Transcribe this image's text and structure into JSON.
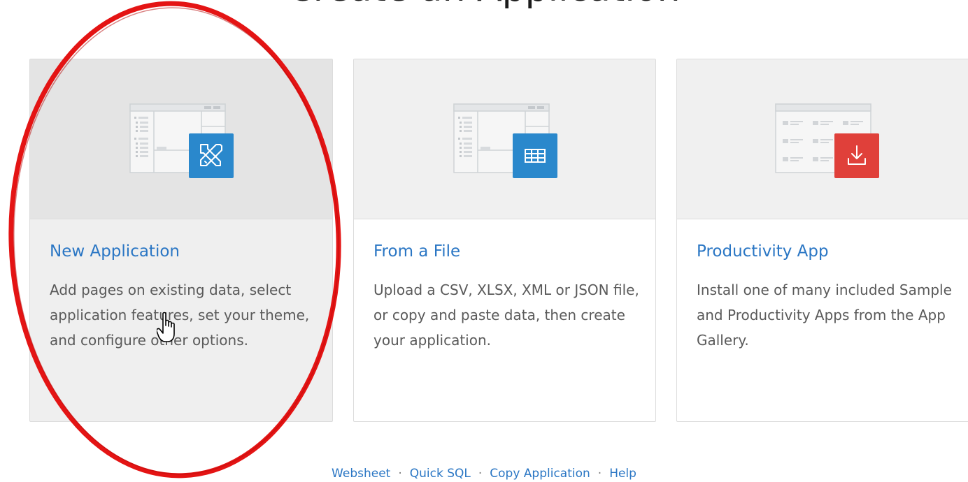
{
  "page": {
    "title": "Create an Application"
  },
  "cards": [
    {
      "title": "New Application",
      "description": "Add pages on existing data, select application features, set your theme, and configure other options.",
      "icon": "pencil-ruler-icon",
      "icon_color": "#2a88cc"
    },
    {
      "title": "From a File",
      "description": "Upload a CSV, XLSX, XML or JSON file, or copy and paste data, then create your application.",
      "icon": "table-grid-icon",
      "icon_color": "#2a88cc"
    },
    {
      "title": "Productivity App",
      "description": "Install one of many included Sample and Productivity Apps from the App Gallery.",
      "icon": "download-icon",
      "icon_color": "#e0403a"
    }
  ],
  "footer": {
    "links": [
      "Websheet",
      "Quick SQL",
      "Copy Application",
      "Help"
    ],
    "separator": "·"
  },
  "colors": {
    "link": "#2a76c4",
    "annotation": "#e41414"
  }
}
